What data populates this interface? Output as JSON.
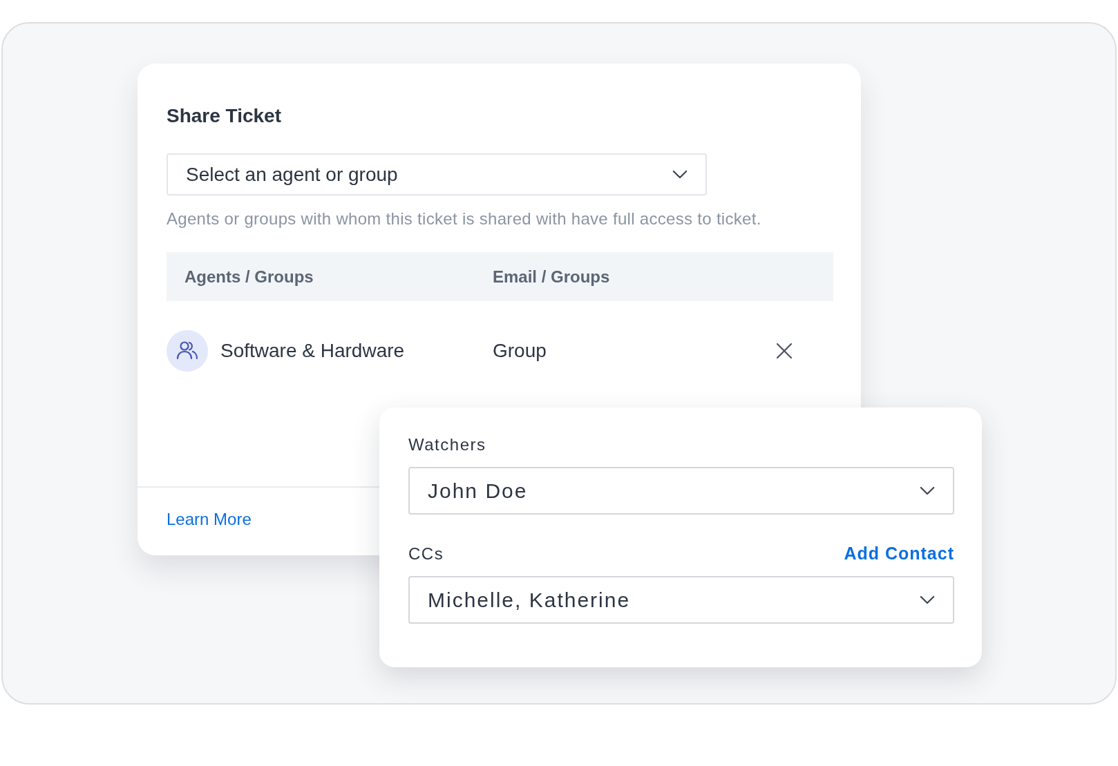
{
  "share_ticket": {
    "title": "Share Ticket",
    "agent_select": {
      "placeholder": "Select an agent or group"
    },
    "help_text": "Agents or groups with whom this ticket is shared with have full access to ticket.",
    "table": {
      "columns": [
        "Agents / Groups",
        "Email / Groups"
      ],
      "rows": [
        {
          "name": "Software & Hardware",
          "type": "Group"
        }
      ]
    },
    "learn_more": "Learn More"
  },
  "watchers_panel": {
    "fields": [
      {
        "label": "Watchers",
        "value": "John Doe"
      },
      {
        "label": "CCs",
        "action": "Add Contact",
        "value": "Michelle, Katherine"
      }
    ]
  }
}
